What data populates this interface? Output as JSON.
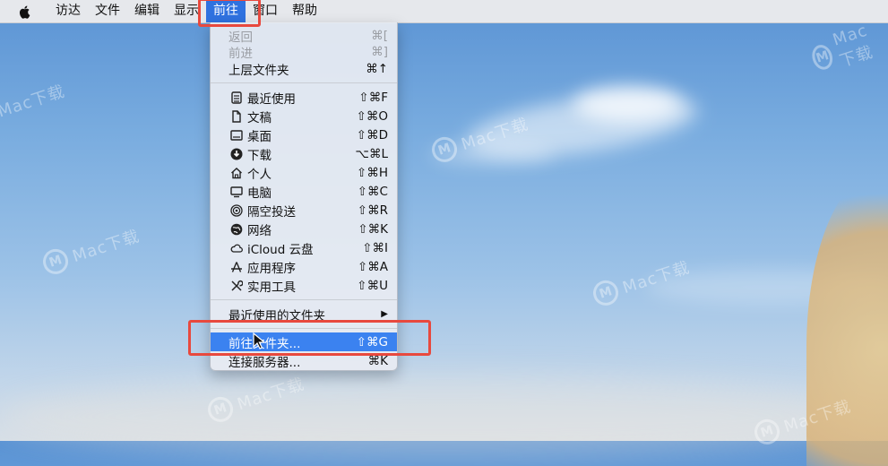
{
  "menubar": {
    "items": [
      "访达",
      "文件",
      "编辑",
      "显示",
      "前往",
      "窗口",
      "帮助"
    ],
    "active": "前往"
  },
  "watermark": {
    "brand": "Mac下载"
  },
  "go_menu": {
    "back": {
      "label": "返回",
      "shortcut": "⌘["
    },
    "forward": {
      "label": "前进",
      "shortcut": "⌘]"
    },
    "enclosing": {
      "label": "上层文件夹",
      "shortcut": "⌘↑"
    },
    "recents": {
      "label": "最近使用",
      "shortcut": "⇧⌘F"
    },
    "documents": {
      "label": "文稿",
      "shortcut": "⇧⌘O"
    },
    "desktop": {
      "label": "桌面",
      "shortcut": "⇧⌘D"
    },
    "downloads": {
      "label": "下载",
      "shortcut": "⌥⌘L"
    },
    "home": {
      "label": "个人",
      "shortcut": "⇧⌘H"
    },
    "computer": {
      "label": "电脑",
      "shortcut": "⇧⌘C"
    },
    "airdrop": {
      "label": "隔空投送",
      "shortcut": "⇧⌘R"
    },
    "network": {
      "label": "网络",
      "shortcut": "⇧⌘K"
    },
    "icloud": {
      "label": "iCloud 云盘",
      "shortcut": "⇧⌘I"
    },
    "applications": {
      "label": "应用程序",
      "shortcut": "⇧⌘A"
    },
    "utilities": {
      "label": "实用工具",
      "shortcut": "⇧⌘U"
    },
    "recent_folders": {
      "label": "最近使用的文件夹",
      "submenu_arrow": "▶"
    },
    "go_to_folder": {
      "label": "前往文件夹...",
      "shortcut": "⇧⌘G"
    },
    "connect_server": {
      "label": "连接服务器...",
      "shortcut": "⌘K"
    }
  },
  "colors": {
    "highlight": "#e8493e",
    "selection": "#3b82f0",
    "menu_active": "#2f72e0"
  }
}
